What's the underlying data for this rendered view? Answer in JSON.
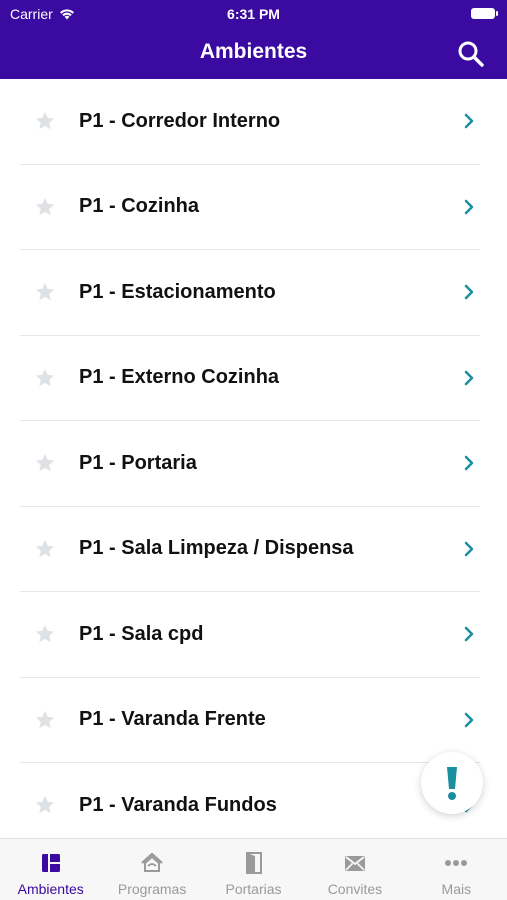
{
  "status_bar": {
    "carrier": "Carrier",
    "time": "6:31 PM"
  },
  "header": {
    "title": "Ambientes"
  },
  "environments": [
    {
      "name": "P1 - Corredor Interno"
    },
    {
      "name": "P1 - Cozinha"
    },
    {
      "name": "P1 - Estacionamento"
    },
    {
      "name": "P1 - Externo Cozinha"
    },
    {
      "name": "P1 - Portaria"
    },
    {
      "name": "P1 - Sala Limpeza / Dispensa"
    },
    {
      "name": "P1 - Sala cpd"
    },
    {
      "name": "P1 - Varanda Frente"
    },
    {
      "name": "P1 - Varanda Fundos"
    }
  ],
  "fab": {
    "icon": "exclamation-icon",
    "glyph": "!"
  },
  "tabs": [
    {
      "label": "Ambientes",
      "icon": "grid-icon",
      "active": true
    },
    {
      "label": "Programas",
      "icon": "house-icon",
      "active": false
    },
    {
      "label": "Portarias",
      "icon": "door-icon",
      "active": false
    },
    {
      "label": "Convites",
      "icon": "envelope-icon",
      "active": false
    },
    {
      "label": "Mais",
      "icon": "more-icon",
      "active": false
    }
  ],
  "colors": {
    "primary": "#3b0aa0",
    "chevron": "#1a8fa0",
    "star": "#dfe2e5",
    "tab_inactive": "#9a9a9a",
    "fab_icon": "#1a8fa0"
  }
}
